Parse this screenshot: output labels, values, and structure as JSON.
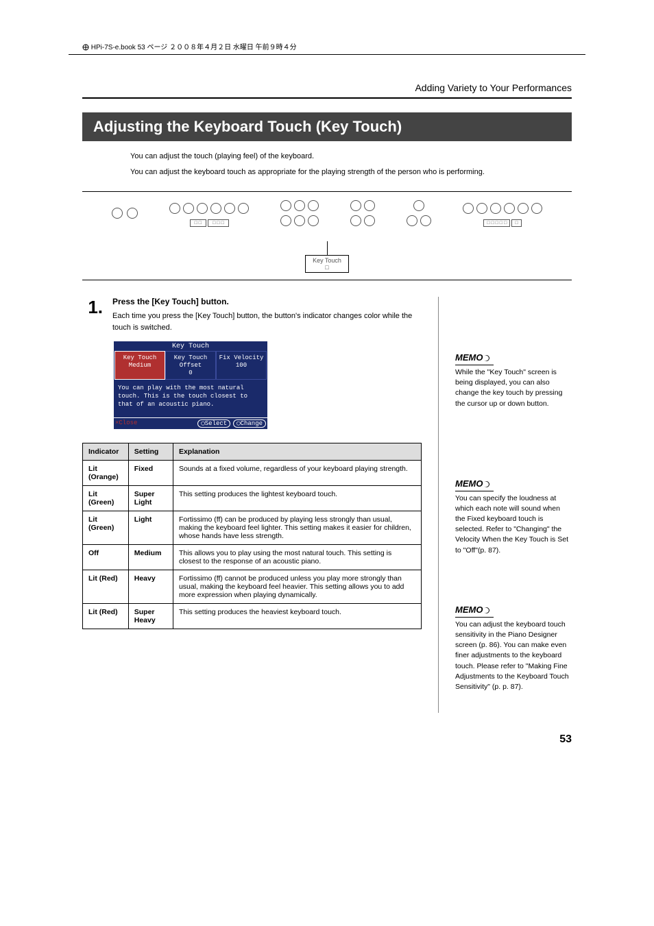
{
  "header": {
    "running": "HPi-7S-e.book 53 ページ ２００８年４月２日 水曜日 午前９時４分",
    "chapter": "Adding Variety to Your Performances"
  },
  "title": "Adjusting the Keyboard Touch (Key Touch)",
  "intro1": "You can adjust the touch (playing feel) of the keyboard.",
  "intro2": "You can adjust the keyboard touch as appropriate for the playing strength of the person who is performing.",
  "callout_label": "Key Touch",
  "step1": {
    "num": "1.",
    "title": "Press the [Key Touch] button.",
    "text": "Each time you press the [Key Touch] button, the button's indicator changes color while the touch is switched."
  },
  "lcd": {
    "title": "Key Touch",
    "c1a": "Key Touch",
    "c1b": "Medium",
    "c2a": "Key Touch Offset",
    "c2b": "0",
    "c3a": "Fix Velocity",
    "c3b": "100",
    "msg": "You can play with the most natural touch. This is the touch closest to that of an acoustic piano.",
    "close": "×Close",
    "select": "◯Select",
    "change": "◯Change"
  },
  "table": {
    "h1": "Indicator",
    "h2": "Setting",
    "h3": "Explanation",
    "rows": [
      {
        "ind": "Lit (Orange)",
        "set": "Fixed",
        "exp": "Sounds at a fixed volume, regardless of your keyboard playing strength."
      },
      {
        "ind": "Lit (Green)",
        "set": "Super Light",
        "exp": "This setting produces the lightest keyboard touch."
      },
      {
        "ind": "Lit (Green)",
        "set": "Light",
        "exp": "Fortissimo (ff) can be produced by playing less strongly than usual, making the keyboard feel lighter. This setting makes it easier for children, whose hands have less strength."
      },
      {
        "ind": "Off",
        "set": "Medium",
        "exp": "This allows you to play using the most natural touch. This setting is closest to the response of an acoustic piano."
      },
      {
        "ind": "Lit (Red)",
        "set": "Heavy",
        "exp": "Fortissimo (ff) cannot be produced unless you play more strongly than usual, making the keyboard feel heavier. This setting allows you to add more expression when playing dynamically."
      },
      {
        "ind": "Lit (Red)",
        "set": "Super Heavy",
        "exp": "This setting produces the heaviest keyboard touch."
      }
    ]
  },
  "memo1": "While the \"Key Touch\" screen is being displayed, you can also change the key touch by pressing the cursor up or down button.",
  "memo2": "You can specify the loudness at which each note will sound when the Fixed keyboard touch is selected. Refer to \"Changing\" the Velocity When the Key Touch is Set to \"Off\"(p. 87).",
  "memo3": "You can adjust the keyboard touch sensitivity in the Piano Designer screen (p. 86). You can make even finer adjustments to the keyboard touch. Please refer to \"Making Fine Adjustments to the Keyboard Touch Sensitivity\" (p. p. 87).",
  "memo_label": "MEMO",
  "page_num": "53"
}
